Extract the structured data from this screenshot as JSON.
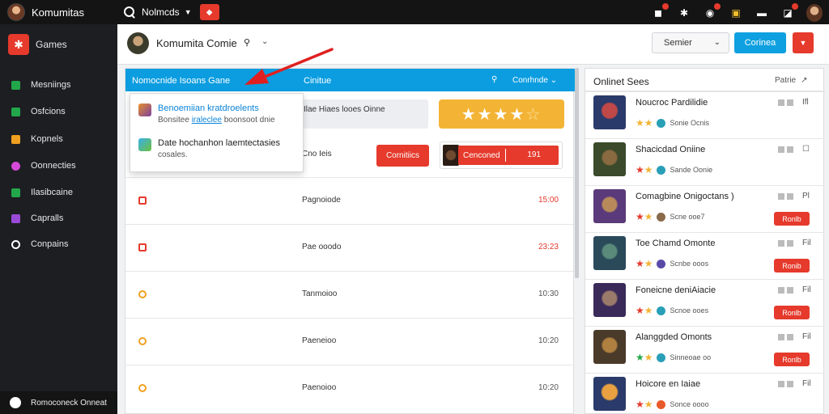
{
  "app": {
    "name": "Komumitas",
    "search_label": "Nolmcds",
    "avatar_icon": "user-avatar"
  },
  "sidebar": {
    "items": [
      {
        "label": "Games",
        "color": "#e53a2c",
        "icon": "games-icon"
      },
      {
        "label": "Mesniings",
        "color": "#22a84a",
        "icon": "messages-icon"
      },
      {
        "label": "Osfcions",
        "color": "#22a84a",
        "icon": "options-icon"
      },
      {
        "label": "Kopnels",
        "color": "#f0a020",
        "icon": "channels-icon"
      },
      {
        "label": "Oonnecties",
        "color": "#d54ad8",
        "icon": "connections-icon"
      },
      {
        "label": "Ilasibcaine",
        "color": "#22a84a",
        "icon": "library-icon"
      },
      {
        "label": "Capralls",
        "color": "#9b4ad8",
        "icon": "capitals-icon"
      },
      {
        "label": "Conpains",
        "color": "#ffffff",
        "icon": "compass-icon"
      }
    ],
    "footer": "Romoconeck Onneat"
  },
  "header": {
    "title": "Komumita Comie",
    "sort_label": "Semier",
    "blue_button": "Corinea"
  },
  "center": {
    "header_left": "Nomocnide Isoans Gane",
    "header_mid": "Cinitue",
    "header_right": "Conrhnde",
    "info_text": "Ilae Hiaes looes Oinne",
    "rating": 4,
    "row1_label": "Cno Ieis",
    "row1_button": "Cornitiics",
    "banner_label": "Cenconed",
    "banner_num": "191",
    "rows": [
      {
        "label": "Pagnoiode",
        "time": "15:00",
        "time_color": "red",
        "status": "red"
      },
      {
        "label": "Pae ooodo",
        "time": "23:23",
        "time_color": "red",
        "status": "red"
      },
      {
        "label": "Tanmoioo",
        "time": "10:30",
        "time_color": "gray",
        "status": "orange"
      },
      {
        "label": "Paeneioo",
        "time": "10:20",
        "time_color": "gray",
        "status": "orange"
      },
      {
        "label": "Paenoioo",
        "time": "10:20",
        "time_color": "gray",
        "status": "orange"
      }
    ]
  },
  "dropdown": {
    "items": [
      {
        "title": "Benoemiian kratdroelents",
        "sub_before": "Bonsitee ",
        "sub_link": "iraleclee",
        "sub_after": " boonsoot dnie",
        "active": true
      },
      {
        "title": "Date hochanhon laemtectasies",
        "sub_before": "cosales.",
        "sub_link": "",
        "sub_after": "",
        "active": false
      }
    ]
  },
  "right": {
    "title": "Onlinet Sees",
    "header_right": "Patrie",
    "games": [
      {
        "name": "Noucroc Pardilidie",
        "meta": "Sonie Ocnis",
        "mark": "Ifl",
        "button": ""
      },
      {
        "name": "Shacicdad Oniine",
        "meta": "Sande Oonie",
        "mark": "☐",
        "button": ""
      },
      {
        "name": "Comagbine Onigoctans )",
        "meta": "Scne ooe7",
        "mark": "Pl",
        "button": "Ronlb"
      },
      {
        "name": "Toe Chamd Omonte",
        "meta": "Scnbe ooos",
        "mark": "Fil",
        "button": "Ronib"
      },
      {
        "name": "Foneicne deniAiacie",
        "meta": "Scnoe ooes",
        "mark": "Fil",
        "button": "Ronlb"
      },
      {
        "name": "Alanggded Omonts",
        "meta": "Sinneoae oo",
        "mark": "Fil",
        "button": "Ronlb"
      },
      {
        "name": "Hoicore en Iaiae",
        "meta": "Sonce oooo",
        "mark": "Fil",
        "button": ""
      }
    ]
  }
}
